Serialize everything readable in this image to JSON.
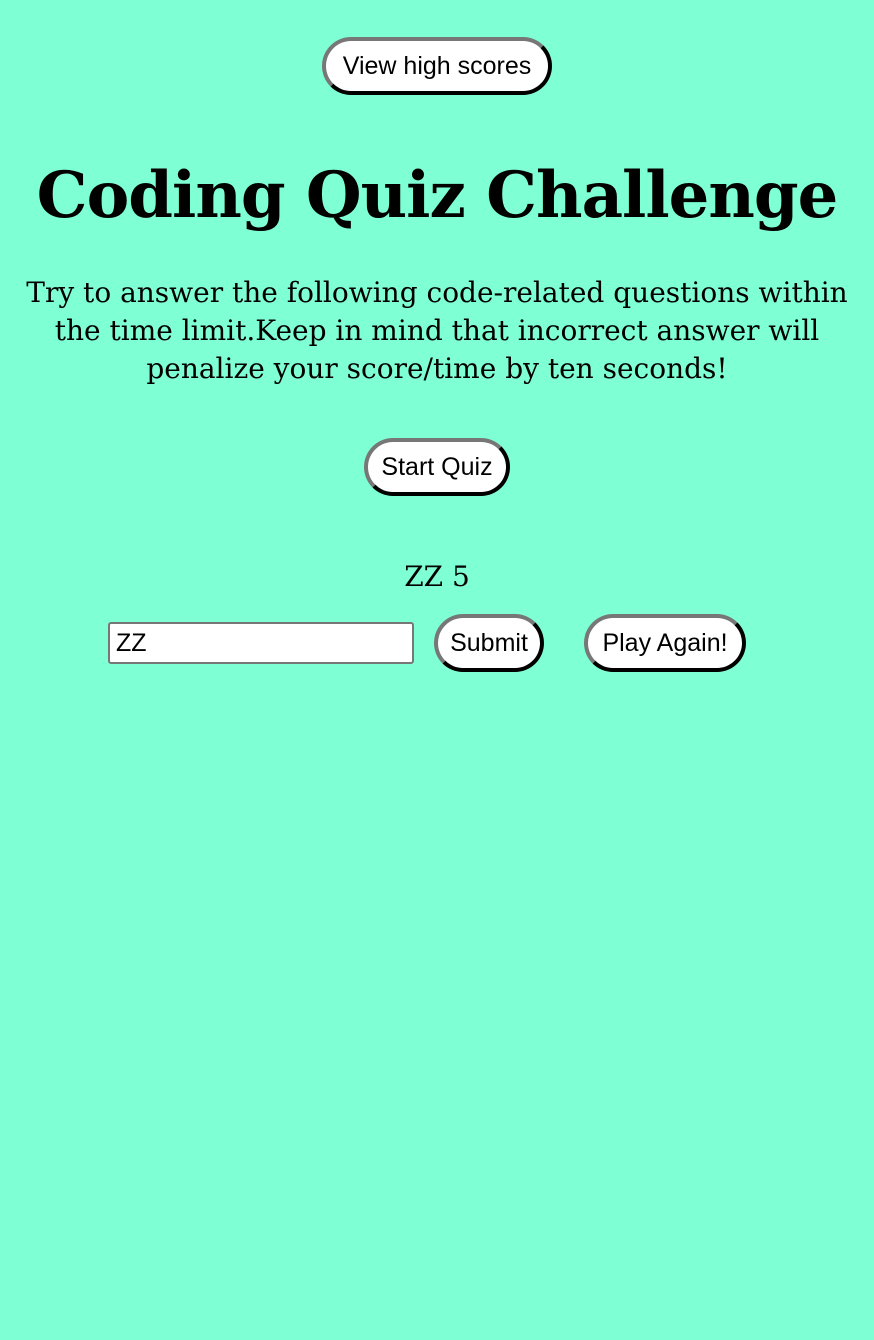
{
  "header": {
    "high_scores_label": "View high scores"
  },
  "main": {
    "title": "Coding Quiz Challenge",
    "intro": "Try to answer the following code-related questions within the time limit.Keep in mind that incorrect answer will penalize your score/time by ten seconds!",
    "start_label": "Start Quiz"
  },
  "result": {
    "score_text": "ZZ 5",
    "initials_value": "ZZ",
    "submit_label": "Submit",
    "play_again_label": "Play Again!"
  },
  "colors": {
    "background": "#7fffd4"
  }
}
